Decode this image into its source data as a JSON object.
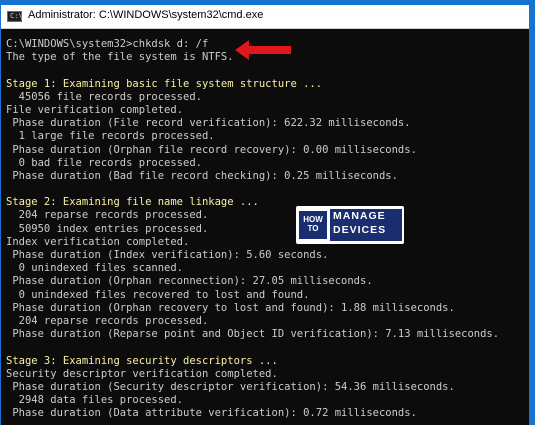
{
  "window": {
    "title": "Administrator: C:\\WINDOWS\\system32\\cmd.exe",
    "icon": "cmd-icon"
  },
  "console": {
    "lines": [
      {
        "text": "C:\\WINDOWS\\system32>chkdsk d: /f",
        "color": "#cccccc"
      },
      {
        "text": "The type of the file system is NTFS.",
        "color": "#cccccc"
      },
      {
        "text": "",
        "color": "#cccccc"
      },
      {
        "text": "Stage 1: Examining basic file system structure ...",
        "color": "#f9f1a5"
      },
      {
        "text": "  45056 file records processed.",
        "color": "#cccccc"
      },
      {
        "text": "File verification completed.",
        "color": "#cccccc"
      },
      {
        "text": " Phase duration (File record verification): 622.32 milliseconds.",
        "color": "#cccccc"
      },
      {
        "text": "  1 large file records processed.",
        "color": "#cccccc"
      },
      {
        "text": " Phase duration (Orphan file record recovery): 0.00 milliseconds.",
        "color": "#cccccc"
      },
      {
        "text": "  0 bad file records processed.",
        "color": "#cccccc"
      },
      {
        "text": " Phase duration (Bad file record checking): 0.25 milliseconds.",
        "color": "#cccccc"
      },
      {
        "text": "",
        "color": "#cccccc"
      },
      {
        "text": "Stage 2: Examining file name linkage ...",
        "color": "#f9f1a5"
      },
      {
        "text": "  204 reparse records processed.",
        "color": "#cccccc"
      },
      {
        "text": "  50950 index entries processed.",
        "color": "#cccccc"
      },
      {
        "text": "Index verification completed.",
        "color": "#cccccc"
      },
      {
        "text": " Phase duration (Index verification): 5.60 seconds.",
        "color": "#cccccc"
      },
      {
        "text": "  0 unindexed files scanned.",
        "color": "#cccccc"
      },
      {
        "text": " Phase duration (Orphan reconnection): 27.05 milliseconds.",
        "color": "#cccccc"
      },
      {
        "text": "  0 unindexed files recovered to lost and found.",
        "color": "#cccccc"
      },
      {
        "text": " Phase duration (Orphan recovery to lost and found): 1.88 milliseconds.",
        "color": "#cccccc"
      },
      {
        "text": "  204 reparse records processed.",
        "color": "#cccccc"
      },
      {
        "text": " Phase duration (Reparse point and Object ID verification): 7.13 milliseconds.",
        "color": "#cccccc"
      },
      {
        "text": "",
        "color": "#cccccc"
      },
      {
        "text": "Stage 3: Examining security descriptors ...",
        "color": "#f9f1a5"
      },
      {
        "text": "Security descriptor verification completed.",
        "color": "#cccccc"
      },
      {
        "text": " Phase duration (Security descriptor verification): 54.36 milliseconds.",
        "color": "#cccccc"
      },
      {
        "text": "  2948 data files processed.",
        "color": "#cccccc"
      },
      {
        "text": " Phase duration (Data attribute verification): 0.72 milliseconds.",
        "color": "#cccccc"
      }
    ]
  },
  "annotation": {
    "icon": "red-arrow-icon",
    "color": "#e0161b"
  },
  "logo": {
    "how": "HOW",
    "to": "TO",
    "manage": "MANAGE",
    "devices": "DEVICES",
    "dark": "#1a2d6e"
  },
  "colors": {
    "background": "#1673d2",
    "console_bg": "#0c0c0c",
    "text": "#cccccc",
    "stage": "#f9f1a5"
  }
}
